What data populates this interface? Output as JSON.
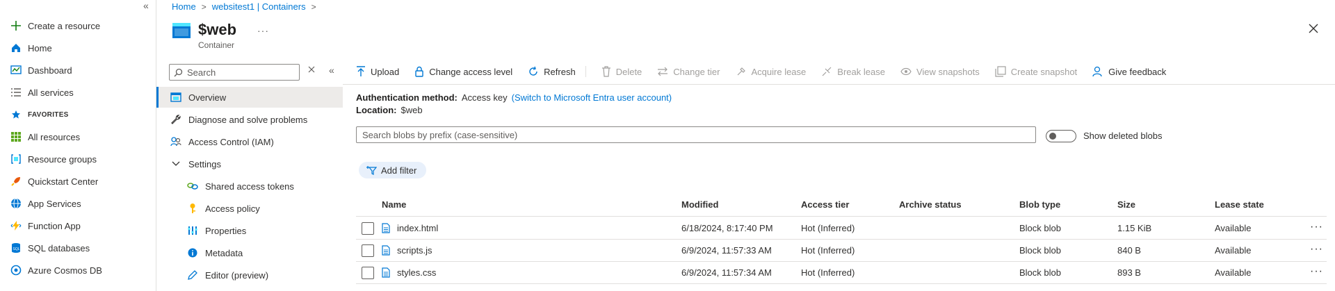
{
  "left_nav": {
    "collapse_glyph": "«",
    "items": [
      {
        "label": "Create a resource",
        "icon": "plus-icon"
      },
      {
        "label": "Home",
        "icon": "home-icon"
      },
      {
        "label": "Dashboard",
        "icon": "dashboard-icon"
      },
      {
        "label": "All services",
        "icon": "list-icon"
      }
    ],
    "favorites_label": "FAVORITES",
    "favorites": [
      {
        "label": "All resources",
        "icon": "grid-icon"
      },
      {
        "label": "Resource groups",
        "icon": "resource-group-icon"
      },
      {
        "label": "Quickstart Center",
        "icon": "rocket-icon"
      },
      {
        "label": "App Services",
        "icon": "globe-icon"
      },
      {
        "label": "Function App",
        "icon": "bolt-icon"
      },
      {
        "label": "SQL databases",
        "icon": "sql-icon"
      },
      {
        "label": "Azure Cosmos DB",
        "icon": "cosmos-icon"
      }
    ]
  },
  "breadcrumb": [
    "Home",
    "websitest1 | Containers"
  ],
  "header": {
    "title": "$web",
    "subtitle": "Container",
    "more": "···"
  },
  "resource_menu": {
    "search_placeholder": "Search",
    "items": [
      {
        "label": "Overview",
        "icon": "overview-icon",
        "active": true
      },
      {
        "label": "Diagnose and solve problems",
        "icon": "wrench-icon"
      },
      {
        "label": "Access Control (IAM)",
        "icon": "people-icon"
      },
      {
        "label": "Settings",
        "icon": "chevron-down-icon"
      },
      {
        "label": "Shared access tokens",
        "icon": "link-icon"
      },
      {
        "label": "Access policy",
        "icon": "key-icon"
      },
      {
        "label": "Properties",
        "icon": "properties-icon"
      },
      {
        "label": "Metadata",
        "icon": "info-icon"
      },
      {
        "label": "Editor (preview)",
        "icon": "pencil-icon"
      }
    ]
  },
  "toolbar": {
    "upload": "Upload",
    "change_access_level": "Change access level",
    "refresh": "Refresh",
    "delete": "Delete",
    "change_tier": "Change tier",
    "acquire_lease": "Acquire lease",
    "break_lease": "Break lease",
    "view_snapshots": "View snapshots",
    "create_snapshot": "Create snapshot",
    "give_feedback": "Give feedback"
  },
  "info": {
    "auth_label": "Authentication method:",
    "auth_value": "Access key",
    "auth_link": "(Switch to Microsoft Entra user account)",
    "location_label": "Location:",
    "location_value": "$web"
  },
  "search_blobs": {
    "placeholder": "Search blobs by prefix (case-sensitive)"
  },
  "show_deleted_label": "Show deleted blobs",
  "add_filter_label": "Add filter",
  "table": {
    "columns": [
      "Name",
      "Modified",
      "Access tier",
      "Archive status",
      "Blob type",
      "Size",
      "Lease state"
    ],
    "rows": [
      {
        "name": "index.html",
        "modified": "6/18/2024, 8:17:40 PM",
        "tier": "Hot (Inferred)",
        "archive": "",
        "type": "Block blob",
        "size": "1.15 KiB",
        "lease": "Available"
      },
      {
        "name": "scripts.js",
        "modified": "6/9/2024, 11:57:33 AM",
        "tier": "Hot (Inferred)",
        "archive": "",
        "type": "Block blob",
        "size": "840 B",
        "lease": "Available"
      },
      {
        "name": "styles.css",
        "modified": "6/9/2024, 11:57:34 AM",
        "tier": "Hot (Inferred)",
        "archive": "",
        "type": "Block blob",
        "size": "893 B",
        "lease": "Available"
      }
    ],
    "row_more": "···"
  },
  "colors": {
    "accent": "#0078d4",
    "disabled": "#a19f9d",
    "active_bg": "#edebe9"
  }
}
